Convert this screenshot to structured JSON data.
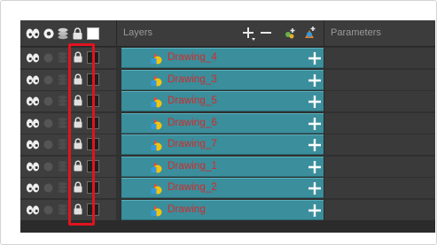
{
  "header": {
    "layers_label": "Layers",
    "parameters_label": "Parameters"
  },
  "layers": [
    {
      "name": "Drawing_4"
    },
    {
      "name": "Drawing_3"
    },
    {
      "name": "Drawing_5"
    },
    {
      "name": "Drawing_6"
    },
    {
      "name": "Drawing_7"
    },
    {
      "name": "Drawing_1"
    },
    {
      "name": "Drawing_2"
    },
    {
      "name": "Drawing"
    }
  ],
  "colors": {
    "layer_row": "#3b8e9b",
    "layer_name": "#d42a2a",
    "highlight": "#e0141e",
    "panel_bg": "#303030"
  },
  "icons": {
    "header": [
      "show-all-eyes-icon",
      "solo-icon",
      "layers-stack-icon",
      "lock-icon",
      "white-square-icon"
    ],
    "row": [
      "eye-icon",
      "solo-icon",
      "layers-stack-icon",
      "lock-icon",
      "colour-swatch-icon"
    ],
    "tools": [
      "add-layer-icon",
      "remove-layer-icon",
      "add-drawing-icon",
      "add-peg-icon"
    ]
  }
}
